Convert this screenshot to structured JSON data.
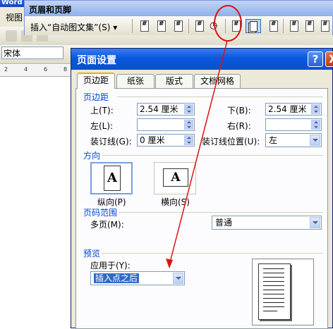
{
  "word": {
    "title": "Word",
    "menu_view": "视图",
    "font_name": "宋体",
    "ruler_ticks": [
      "2",
      "4",
      "6",
      "8"
    ]
  },
  "hf_toolbar": {
    "title": "页眉和页脚",
    "autotext_label": "插入“自动图文集”(S)",
    "icons": [
      "insert-page-number-icon",
      "insert-page-count-icon",
      "format-page-number-icon",
      "insert-date-icon",
      "insert-time-icon",
      "page-setup-icon",
      "show-hide-text-icon",
      "same-as-previous-icon",
      "switch-header-footer-icon",
      "show-previous-icon",
      "show-next-icon"
    ]
  },
  "dialog": {
    "title": "页面设置",
    "help": "?",
    "close": "X",
    "tabs": [
      "页边距",
      "纸张",
      "版式",
      "文档网格"
    ],
    "margins_group": "页边距",
    "top_label": "上(T):",
    "top_value": "2.54 厘米",
    "bottom_label": "下(B):",
    "bottom_value": "2.54 厘米",
    "left_label": "左(L):",
    "left_value": "",
    "right_label": "右(R):",
    "right_value": "",
    "gutter_label": "装订线(G):",
    "gutter_value": "0 厘米",
    "gutter_pos_label": "装订线位置(U):",
    "gutter_pos_value": "左",
    "orientation_group": "方向",
    "portrait_label": "纵向(P)",
    "landscape_label": "横向(S)",
    "orientation_letter": "A",
    "pages_group": "页码范围",
    "multiple_pages_label": "多页(M):",
    "multiple_pages_value": "普通",
    "preview_group": "预览",
    "apply_to_label": "应用于(Y):",
    "apply_to_value": "插入点之后"
  },
  "annotation_color": "#e01010"
}
